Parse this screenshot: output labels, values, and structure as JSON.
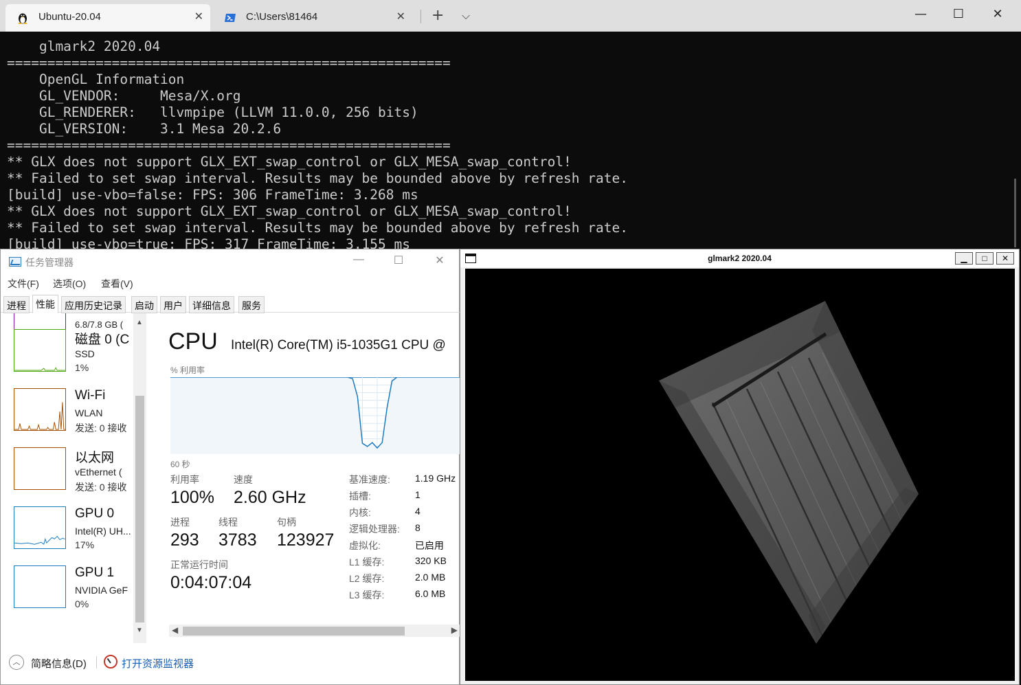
{
  "terminal": {
    "tabs": [
      {
        "label": "Ubuntu-20.04",
        "icon": "linux-penguin-icon",
        "active": true
      },
      {
        "label": "C:\\Users\\81464",
        "icon": "powershell-icon",
        "active": false
      }
    ],
    "lines": [
      "    glmark2 2020.04",
      "=======================================================",
      "    OpenGL Information",
      "    GL_VENDOR:     Mesa/X.org",
      "    GL_RENDERER:   llvmpipe (LLVM 11.0.0, 256 bits)",
      "    GL_VERSION:    3.1 Mesa 20.2.6",
      "=======================================================",
      "** GLX does not support GLX_EXT_swap_control or GLX_MESA_swap_control!",
      "** Failed to set swap interval. Results may be bounded above by refresh rate.",
      "[build] use-vbo=false: FPS: 306 FrameTime: 3.268 ms",
      "** GLX does not support GLX_EXT_swap_control or GLX_MESA_swap_control!",
      "** Failed to set swap interval. Results may be bounded above by refresh rate.",
      "[build] use-vbo=true: FPS: 317 FrameTime: 3.155 ms"
    ]
  },
  "taskmanager": {
    "title": "任务管理器",
    "menu": [
      "文件(F)",
      "选项(O)",
      "查看(V)"
    ],
    "tabs": [
      "进程",
      "性能",
      "应用历史记录",
      "启动",
      "用户",
      "详细信息",
      "服务"
    ],
    "active_tab": "性能",
    "sidebar": {
      "memory_partial": "6.8/7.8 GB (",
      "items": [
        {
          "name": "磁盘 0 (C",
          "sub1": "SSD",
          "sub2": "1%",
          "color": "#4da60c"
        },
        {
          "name": "Wi-Fi",
          "sub1": "WLAN",
          "sub2": "发送: 0 接收",
          "color": "#a74f01"
        },
        {
          "name": "以太网",
          "sub1": "vEthernet (",
          "sub2": "发送: 0 接收",
          "color": "#a74f01"
        },
        {
          "name": "GPU 0",
          "sub1": "Intel(R) UH...",
          "sub2": "17%",
          "color": "#1c7bbf"
        },
        {
          "name": "GPU 1",
          "sub1": "NVIDIA GeF",
          "sub2": "0%",
          "color": "#1c7bbf"
        }
      ]
    },
    "cpu": {
      "title": "CPU",
      "model": "Intel(R) Core(TM) i5-1035G1 CPU @",
      "util_axis_label": "% 利用率",
      "time_label": "60 秒",
      "graph_color": "#1c7bbf",
      "graph_fill": "#f1f6fa",
      "utilization_history": [
        100,
        100,
        100,
        100,
        100,
        100,
        100,
        100,
        100,
        100,
        100,
        100,
        100,
        100,
        100,
        100,
        100,
        100,
        100,
        100,
        100,
        100,
        100,
        100,
        100,
        100,
        100,
        100,
        100,
        100,
        100,
        100,
        100,
        100,
        100,
        100,
        100,
        98,
        75,
        14,
        10,
        15,
        8,
        15,
        60,
        95,
        100,
        100,
        100,
        100,
        100,
        100,
        100,
        100,
        100,
        100,
        100,
        100,
        100,
        100,
        100
      ],
      "stats": {
        "util_label": "利用率",
        "util_value": "100%",
        "speed_label": "速度",
        "speed_value": "2.60 GHz",
        "proc_label": "进程",
        "proc_value": "293",
        "thread_label": "线程",
        "thread_value": "3783",
        "handle_label": "句柄",
        "handle_value": "123927",
        "uptime_label": "正常运行时间",
        "uptime_value": "0:04:07:04"
      },
      "specs": [
        {
          "label": "基准速度:",
          "value": "1.19 GHz"
        },
        {
          "label": "插槽:",
          "value": "1"
        },
        {
          "label": "内核:",
          "value": "4"
        },
        {
          "label": "逻辑处理器:",
          "value": "8"
        },
        {
          "label": "虚拟化:",
          "value": "已启用"
        },
        {
          "label": "L1 缓存:",
          "value": "320 KB"
        },
        {
          "label": "L2 缓存:",
          "value": "2.0 MB"
        },
        {
          "label": "L3 缓存:",
          "value": "6.0 MB"
        }
      ]
    },
    "footer": {
      "fewer_details": "简略信息(D)",
      "open_resmon": "打开资源监视器"
    }
  },
  "glmark": {
    "title": "glmark2 2020.04",
    "scene": "wooden-crate-texture"
  }
}
